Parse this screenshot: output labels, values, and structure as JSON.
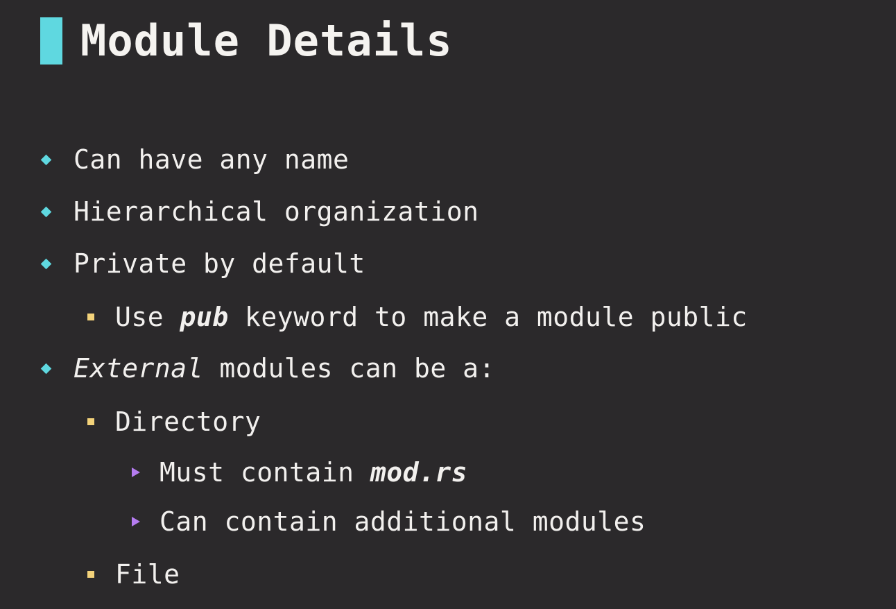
{
  "slide": {
    "title": "Module Details",
    "colors": {
      "background": "#2b292b",
      "title_accent": "#5fd8e0",
      "level1_marker": "#5fd8e0",
      "level2_marker": "#f3d27a",
      "level3_marker": "#b57cf0",
      "text": "#f2f0ee"
    },
    "items": [
      {
        "level": 1,
        "text": "Can have any name"
      },
      {
        "level": 1,
        "text": "Hierarchical organization"
      },
      {
        "level": 1,
        "text": "Private by default"
      },
      {
        "level": 2,
        "pre": "Use ",
        "strong": "pub",
        "post": " keyword to make a module public"
      },
      {
        "level": 1,
        "em": "External",
        "post": " modules can be a:"
      },
      {
        "level": 2,
        "text": "Directory"
      },
      {
        "level": 3,
        "pre": "Must contain ",
        "strong": "mod.rs"
      },
      {
        "level": 3,
        "text": "Can contain additional modules"
      },
      {
        "level": 2,
        "text": "File"
      }
    ]
  }
}
